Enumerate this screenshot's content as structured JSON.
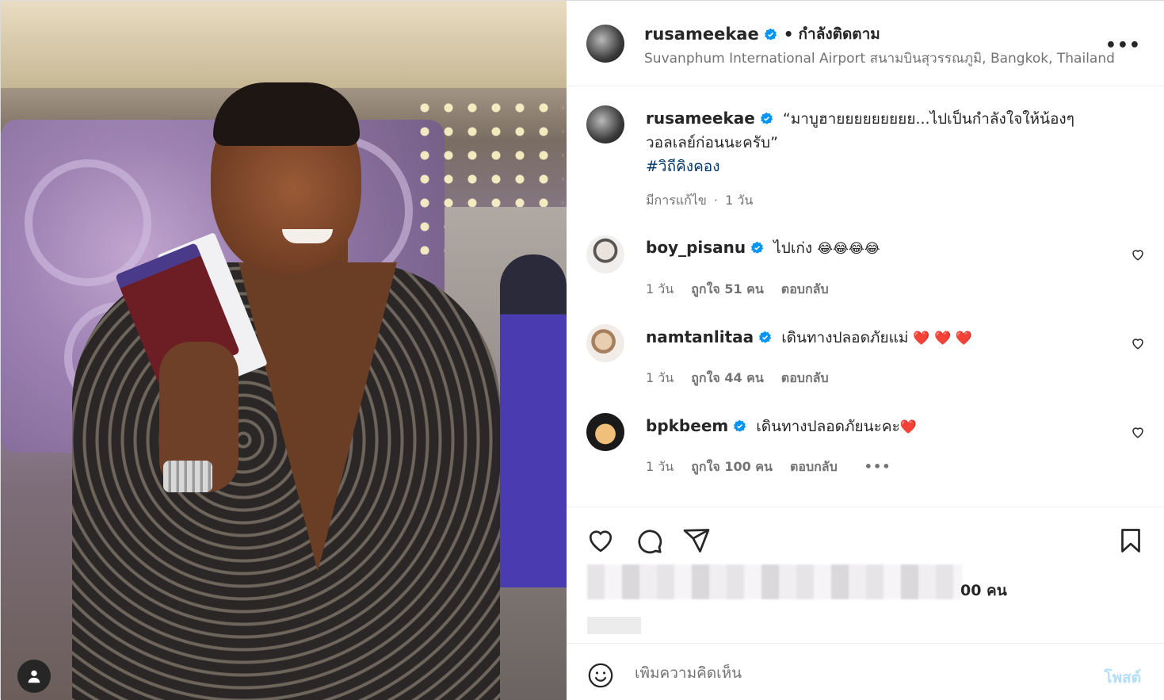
{
  "post": {
    "username": "rusameekae",
    "separator": "•",
    "follow_status": "กำลังติดตาม",
    "location": "Suvanphum International Airport สนามบินสุวรรณภูมิ, Bangkok, Thailand",
    "more": "•••"
  },
  "caption": {
    "username": "rusameekae",
    "line1": "“มาบูฮายยยยยยยยย...ไปเป็นกำลังใจให้น้องๆ",
    "line2": "วอลเลย์ก่อนนะครับ”",
    "hashtag": "#วิถีคิงคอง",
    "edited": "มีการแก้ไข",
    "meta_dot": "·",
    "time": "1 วัน"
  },
  "comments": [
    {
      "username": "boy_pisanu",
      "text": "ไปเก่ง",
      "emojis": "😂😂😂😂",
      "time": "1 วัน",
      "likes": "ถูกใจ 51 คน",
      "reply": "ตอบกลับ",
      "more": ""
    },
    {
      "username": "namtanlitaa",
      "text": "เดินทางปลอดภัยแม่",
      "emojis": "❤️ ❤️ ❤️",
      "time": "1 วัน",
      "likes": "ถูกใจ 44 คน",
      "reply": "ตอบกลับ",
      "more": ""
    },
    {
      "username": "bpkbeem",
      "text": "เดินทางปลอดภัยนะคะ",
      "emojis": "❤️",
      "time": "1 วัน",
      "likes": "ถูกใจ 100 คน",
      "reply": "ตอบกลับ",
      "more": "•••"
    }
  ],
  "likes_summary": {
    "visible_suffix": "00 คน"
  },
  "comment_box": {
    "placeholder": "เพิ่มความคิดเห็น",
    "post_label": "โพสต์"
  },
  "colors": {
    "verified": "#0095f6",
    "link": "#00376b",
    "post_disabled": "#b2dffc",
    "muted": "#737373"
  },
  "icons": [
    "verified-icon",
    "more-icon",
    "heart-icon",
    "comment-icon",
    "share-icon",
    "bookmark-icon",
    "emoji-icon",
    "profile-icon"
  ]
}
